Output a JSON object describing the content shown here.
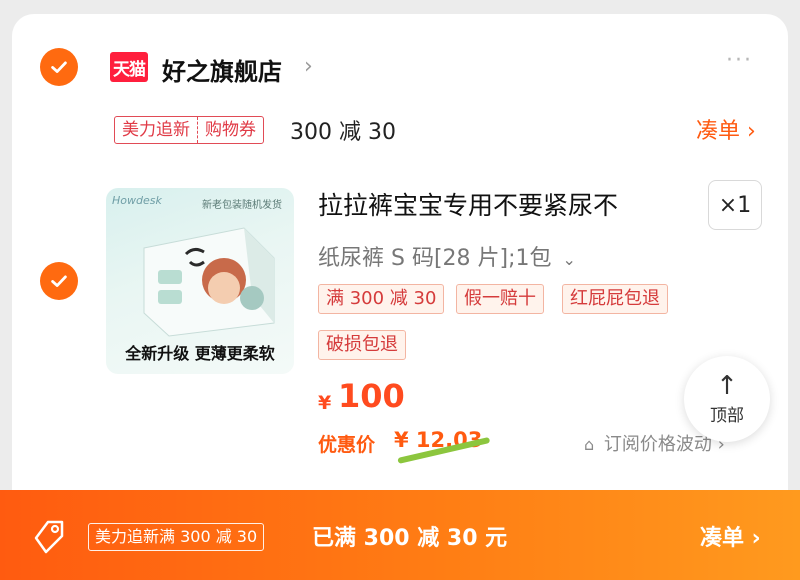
{
  "shop": {
    "badge": "天猫",
    "name": "好之旗舰店",
    "chevron": "›",
    "more": "···"
  },
  "promo": {
    "tags": [
      "美力追新",
      "购物券"
    ],
    "text": "300 减 30",
    "link": "凑单 ›"
  },
  "product": {
    "image": {
      "brand": "Howdesk",
      "top_text": "新老包装随机发货",
      "bottom_text": "全新升级 更薄更柔软"
    },
    "title": "拉拉裤宝宝专用不要紧尿不",
    "quantity": "×1",
    "sku": "纸尿裤 S 码[28 片];1包",
    "sku_chevron": "⌄",
    "tags": [
      "满 300 减 30",
      "假一赔十",
      "红屁屁包退",
      "破损包退"
    ],
    "price_symbol": "¥",
    "price": "100",
    "deal_label": "优惠价",
    "deal_price": "¥ 12.03",
    "subscribe_icon": "⌂",
    "subscribe": "订阅价格波动 ›"
  },
  "back_to_top": {
    "arrow": "↑",
    "label": "顶部"
  },
  "bottom_bar": {
    "tag": "美力追新满 300 减 30",
    "text": "已满 300 减 30 元",
    "link": "凑单 ›"
  },
  "colors": {
    "accent": "#ff6a10",
    "tmall_red": "#ff1f3d",
    "tag_red": "#d53b3b",
    "bar_start": "#ff5b10",
    "bar_end": "#ff9a1e"
  },
  "icons": {
    "select": "check-circle-icon",
    "shop": "tmall-logo-icon",
    "ticket": "coupon-icon",
    "top": "arrow-up-icon"
  }
}
